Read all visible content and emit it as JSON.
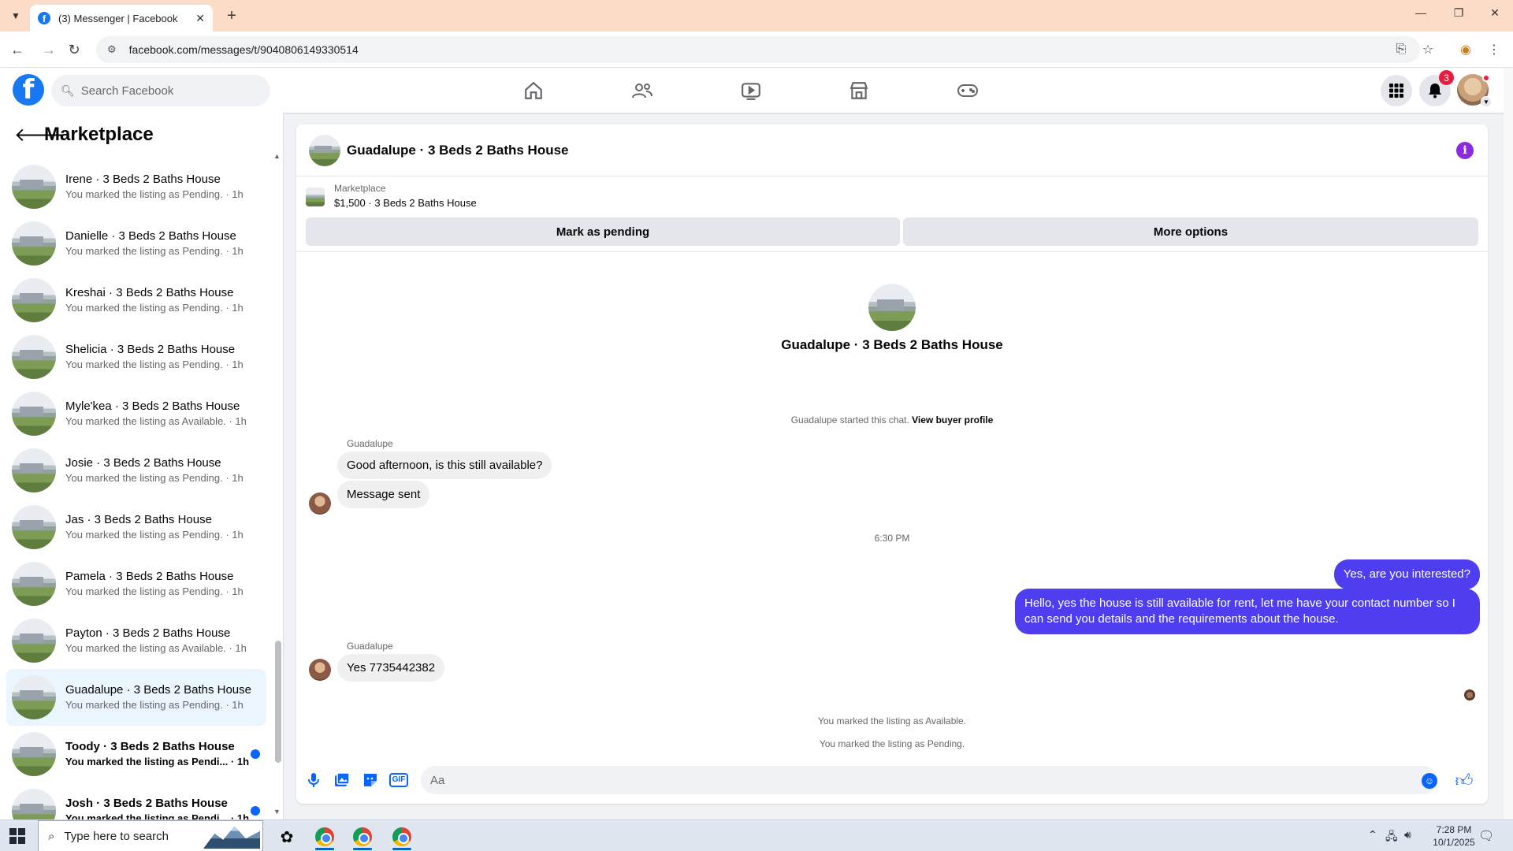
{
  "browser": {
    "tab_title": "(3) Messenger | Facebook",
    "url": "facebook.com/messages/t/9040806149330514"
  },
  "header": {
    "search_placeholder": "Search Facebook",
    "notification_count": "3"
  },
  "sidebar": {
    "title": "Marketplace",
    "conversations": [
      {
        "name": "Irene · 3 Beds 2 Baths House",
        "sub": "You marked the listing as Pending. · 1h"
      },
      {
        "name": "Danielle · 3 Beds 2 Baths House",
        "sub": "You marked the listing as Pending. · 1h"
      },
      {
        "name": "Kreshai · 3 Beds 2 Baths House",
        "sub": "You marked the listing as Pending. · 1h"
      },
      {
        "name": "Shelicia · 3 Beds 2 Baths House",
        "sub": "You marked the listing as Pending. · 1h"
      },
      {
        "name": "Myle'kea · 3 Beds 2 Baths House",
        "sub": "You marked the listing as Available. · 1h"
      },
      {
        "name": "Josie · 3 Beds 2 Baths House",
        "sub": "You marked the listing as Pending. · 1h"
      },
      {
        "name": "Jas · 3 Beds 2 Baths House",
        "sub": "You marked the listing as Pending. · 1h"
      },
      {
        "name": "Pamela · 3 Beds 2 Baths House",
        "sub": "You marked the listing as Pending. · 1h"
      },
      {
        "name": "Payton · 3 Beds 2 Baths House",
        "sub": "You marked the listing as Available. · 1h"
      },
      {
        "name": "Guadalupe · 3 Beds 2 Baths House",
        "sub": "You marked the listing as Pending. · 1h"
      },
      {
        "name": "Toody · 3 Beds 2 Baths House",
        "sub": "You marked the listing as Pendi... · 1h"
      },
      {
        "name": "Josh · 3 Beds 2 Baths House",
        "sub": "You marked the listing as Pendi... · 1h"
      }
    ]
  },
  "chat": {
    "title": "Guadalupe · 3 Beds 2 Baths House",
    "listing_label": "Marketplace",
    "listing_price": "$1,500 · 3 Beds 2 Baths House",
    "mark_pending_label": "Mark as pending",
    "more_options_label": "More options",
    "intro_title": "Guadalupe · 3 Beds 2 Baths House",
    "started_text": "Guadalupe started this chat.",
    "view_profile_label": "View buyer profile",
    "sender_name": "Guadalupe",
    "msg_in_1": "Good afternoon, is this still available?",
    "msg_in_2": "Message sent",
    "timestamp": "6:30 PM",
    "msg_out_1": "Yes, are you interested?",
    "msg_out_2": "Hello, yes the house is still available for rent, let me have your contact number so I can send you details and the requirements about the house.",
    "msg_in_3": "Yes 7735442382",
    "sys_available": "You marked the listing as Available.",
    "sys_pending": "You marked the listing as Pending.",
    "composer_placeholder": "Aa"
  },
  "taskbar": {
    "search_placeholder": "Type here to search",
    "time": "7:28 PM",
    "date": "10/1/2025"
  }
}
